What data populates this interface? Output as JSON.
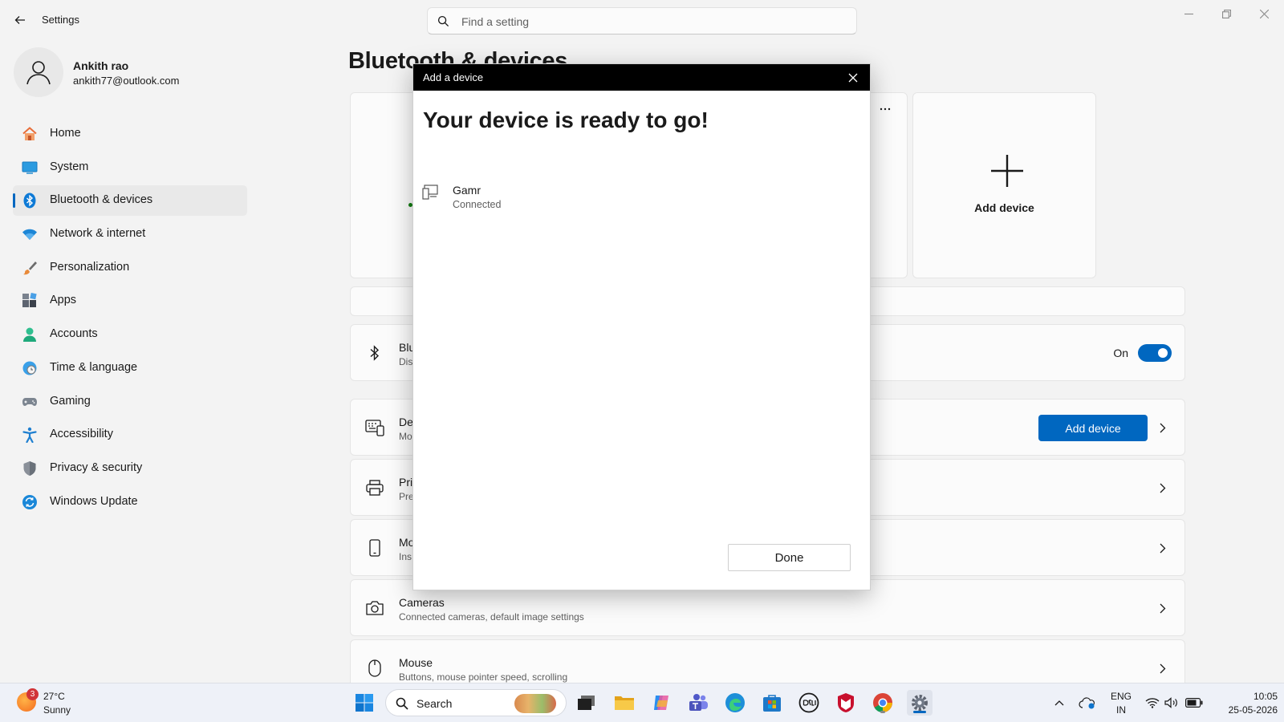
{
  "window": {
    "app_title": "Settings",
    "search_placeholder": "Find a setting"
  },
  "profile": {
    "name": "Ankith rao",
    "email": "ankith77@outlook.com"
  },
  "sidebar": {
    "items": [
      {
        "label": "Home",
        "icon": "home-icon"
      },
      {
        "label": "System",
        "icon": "system-icon"
      },
      {
        "label": "Bluetooth & devices",
        "icon": "bluetooth-icon",
        "active": true
      },
      {
        "label": "Network & internet",
        "icon": "wifi-icon"
      },
      {
        "label": "Personalization",
        "icon": "brush-icon"
      },
      {
        "label": "Apps",
        "icon": "apps-icon"
      },
      {
        "label": "Accounts",
        "icon": "accounts-icon"
      },
      {
        "label": "Time & language",
        "icon": "globe-clock-icon"
      },
      {
        "label": "Gaming",
        "icon": "gamepad-icon"
      },
      {
        "label": "Accessibility",
        "icon": "accessibility-icon"
      },
      {
        "label": "Privacy & security",
        "icon": "shield-icon"
      },
      {
        "label": "Windows Update",
        "icon": "update-icon"
      }
    ]
  },
  "main": {
    "page_title": "Bluetooth & devices",
    "add_card_label": "Add device",
    "bluetooth_row": {
      "title": "Blu",
      "sub": "Dis",
      "toggle_label": "On",
      "toggle_on": true
    },
    "devices_row": {
      "title": "De",
      "sub": "Mo",
      "button_label": "Add device"
    },
    "printers_row": {
      "title": "Pri",
      "sub": "Pre"
    },
    "mobile_row": {
      "title": "Mo",
      "sub": "Ins"
    },
    "cameras_row": {
      "title": "Cameras",
      "sub": "Connected cameras, default image settings"
    },
    "mouse_row": {
      "title": "Mouse",
      "sub": "Buttons, mouse pointer speed, scrolling"
    }
  },
  "dialog": {
    "bar_title": "Add a device",
    "heading": "Your device is ready to go!",
    "device_name": "Gamr",
    "device_status": "Connected",
    "done_label": "Done"
  },
  "taskbar": {
    "weather_badge": "3",
    "weather_temp": "27°C",
    "weather_condition": "Sunny",
    "search_label": "Search",
    "lang_top": "ENG",
    "lang_bottom": "IN",
    "time": "10:05",
    "date": "25-05-2026"
  },
  "colors": {
    "accent": "#0067c0",
    "dialog_bar": "#000000",
    "background": "#f3f3f3"
  }
}
